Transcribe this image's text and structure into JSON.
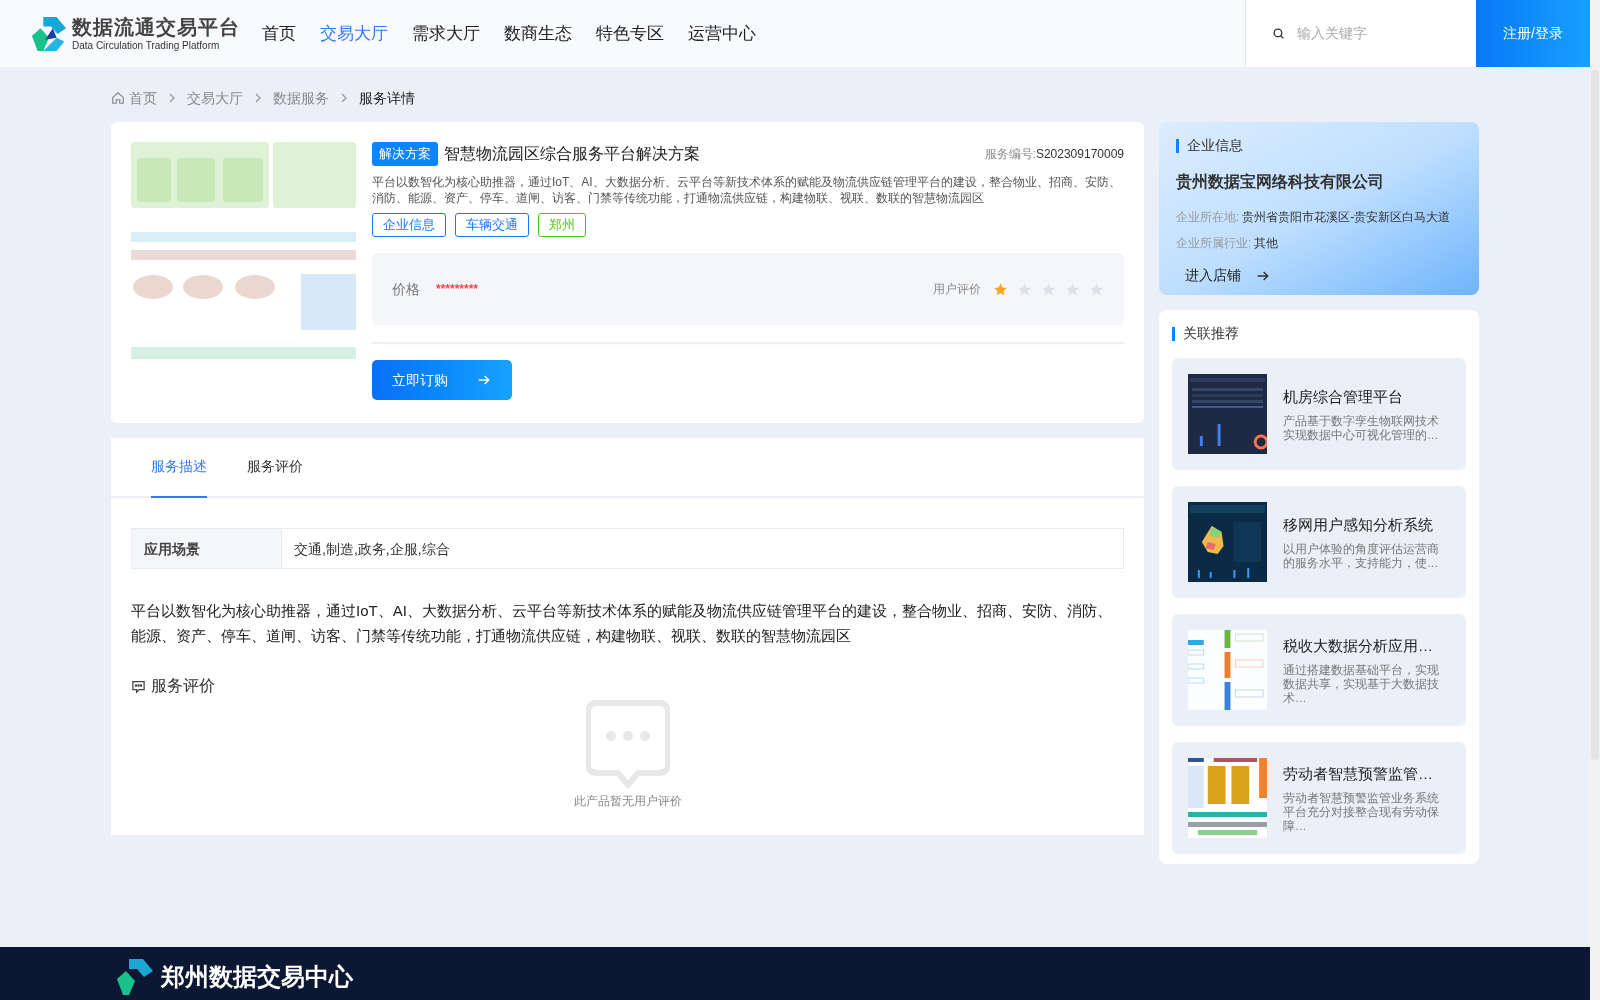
{
  "header": {
    "logo_title": "数据流通交易平台",
    "logo_subtitle": "Data Circulation Trading Platform",
    "nav": [
      {
        "label": "首页",
        "selected": false
      },
      {
        "label": "交易大厅",
        "selected": true
      },
      {
        "label": "需求大厅",
        "selected": false
      },
      {
        "label": "数商生态",
        "selected": false
      },
      {
        "label": "特色专区",
        "selected": false
      },
      {
        "label": "运营中心",
        "selected": false
      }
    ],
    "search": {
      "placeholder": "输入关键字"
    },
    "login_button": "注册/登录"
  },
  "breadcrumb": [
    "首页",
    "交易大厅",
    "数据服务",
    "服务详情"
  ],
  "product": {
    "badge": "解决方案",
    "title": "智慧物流园区综合服务平台解决方案",
    "code_label": "服务编号:",
    "code": "S202309170009",
    "summary": "平台以数智化为核心助推器，通过IoT、AI、大数据分析、云平台等新技术体系的赋能及物流供应链管理平台的建设，整合物业、招商、安防、消防、能源、资产、停车、道闸、访客、门禁等传统功能，打通物流供应链，构建物联、视联、数联的智慧物流园区",
    "tags": [
      {
        "label": "企业信息",
        "color": "#1677ff"
      },
      {
        "label": "车辆交通",
        "color": "#1677ff"
      },
      {
        "label": "郑州",
        "color": "#52c41a"
      }
    ],
    "price_label": "价格",
    "price": "*********",
    "rating_label": "用户评价",
    "stars": 1,
    "order_button": "立即订购"
  },
  "detail_tabs": [
    {
      "label": "服务描述",
      "selected": true
    },
    {
      "label": "服务评价",
      "selected": false
    }
  ],
  "scenario": {
    "label": "应用场景",
    "value": "交通,制造,政务,企服,综合"
  },
  "description": "平台以数智化为核心助推器，通过IoT、AI、大数据分析、云平台等新技术体系的赋能及物流供应链管理平台的建设，整合物业、招商、安防、消防、能源、资产、停车、道闸、访客、门禁等传统功能，打通物流供应链，构建物联、视联、数联的智慧物流园区",
  "reviews": {
    "title": "服务评价",
    "empty_text": "此产品暂无用户评价"
  },
  "company": {
    "heading": "企业信息",
    "name": "贵州数据宝网络科技有限公司",
    "location_label": "企业所在地:",
    "location": "贵州省贵阳市花溪区-贵安新区白马大道",
    "industry_label": "企业所属行业:",
    "industry": "其他",
    "shop_button": "进入店铺"
  },
  "related": {
    "heading": "关联推荐",
    "items": [
      {
        "title": "机房综合管理平台",
        "desc": "产品基于数字孪生物联网技术实现数据中心可视化管理的…"
      },
      {
        "title": "移网用户感知分析系统",
        "desc": "以用户体验的角度评估运营商的服务水平，支持能力，使…"
      },
      {
        "title": "税收大数据分析应用…",
        "desc": "通过搭建数据基础平台，实现数据共享，实现基于大数据技术…"
      },
      {
        "title": "劳动者智慧预警监管…",
        "desc": "劳动者智慧预警监管业务系统平台充分对接整合现有劳动保障…"
      }
    ]
  },
  "footer": {
    "title": "郑州数据交易中心"
  }
}
